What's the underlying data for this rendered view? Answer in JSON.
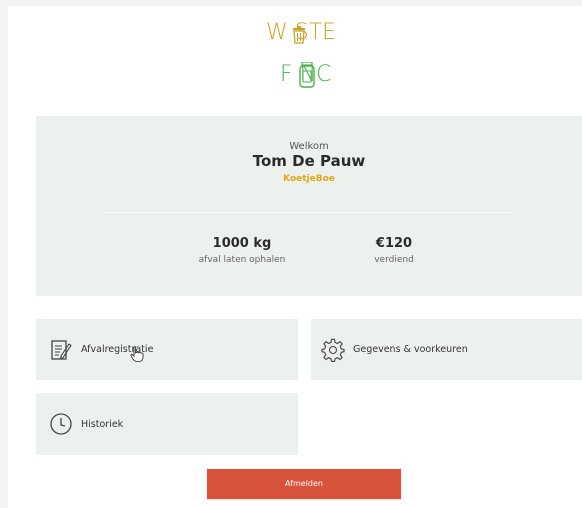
{
  "logo": {
    "line1": "W   STE",
    "line2": "F   NC",
    "brand_yellow": "#c9a227",
    "brand_green": "#4caf50"
  },
  "welcome": {
    "label": "Welkom",
    "name": "Tom De Pauw",
    "team": "KoetjeBoe"
  },
  "stats": [
    {
      "value": "1000 kg",
      "label": "afval laten ophalen"
    },
    {
      "value": "€120",
      "label": "verdiend"
    }
  ],
  "tiles": [
    {
      "label": "Afvalregistratie",
      "icon": "document-edit-icon"
    },
    {
      "label": "Gegevens & voorkeuren",
      "icon": "gear-icon"
    },
    {
      "label": "Historiek",
      "icon": "clock-icon"
    }
  ],
  "logout": {
    "label": "Afmelden",
    "color": "#d9533a"
  },
  "colors": {
    "panel": "#edf1ee",
    "accent_yellow": "#e2a718"
  }
}
